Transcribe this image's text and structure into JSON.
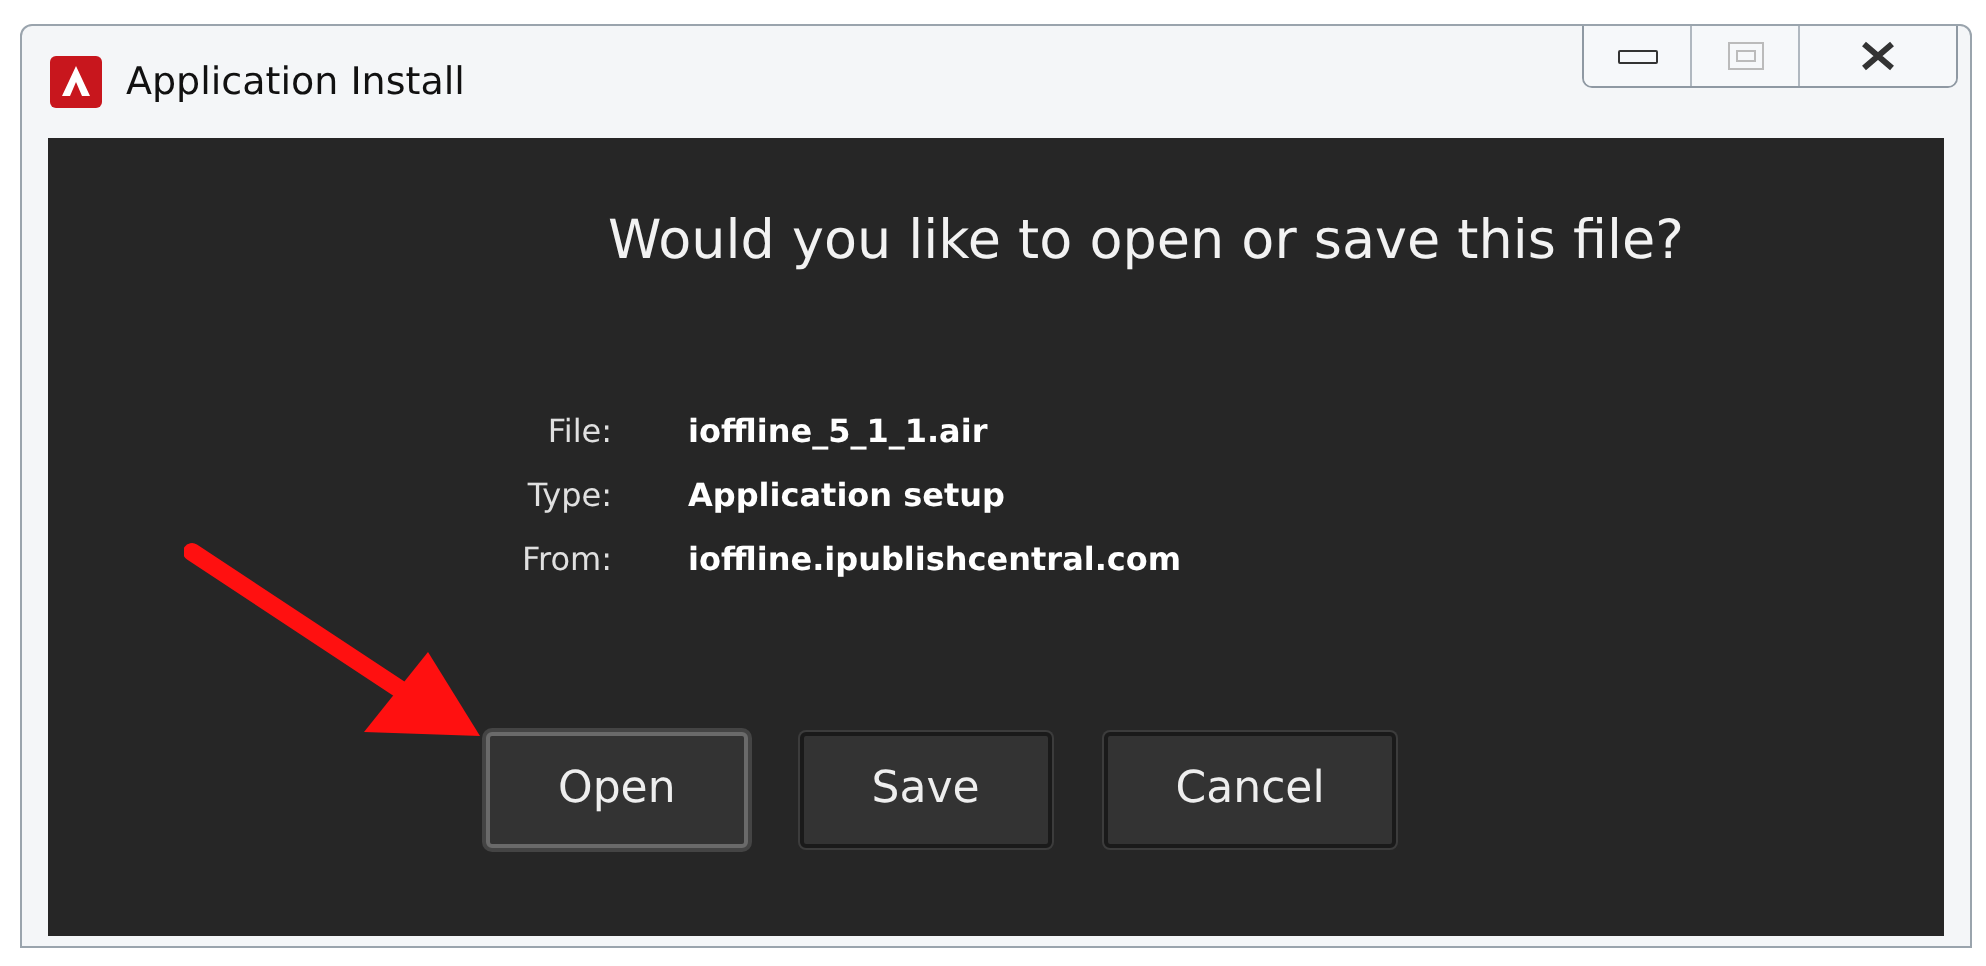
{
  "window": {
    "title": "Application Install"
  },
  "heading": "Would you like to open or save this file?",
  "details": [
    {
      "label": "File:",
      "value": "ioffline_5_1_1.air"
    },
    {
      "label": "Type:",
      "value": "Application setup"
    },
    {
      "label": "From:",
      "value": "ioffline.ipublishcentral.com"
    }
  ],
  "buttons": [
    {
      "label": "Open",
      "focused": true
    },
    {
      "label": "Save",
      "focused": false
    },
    {
      "label": "Cancel",
      "focused": false
    }
  ]
}
